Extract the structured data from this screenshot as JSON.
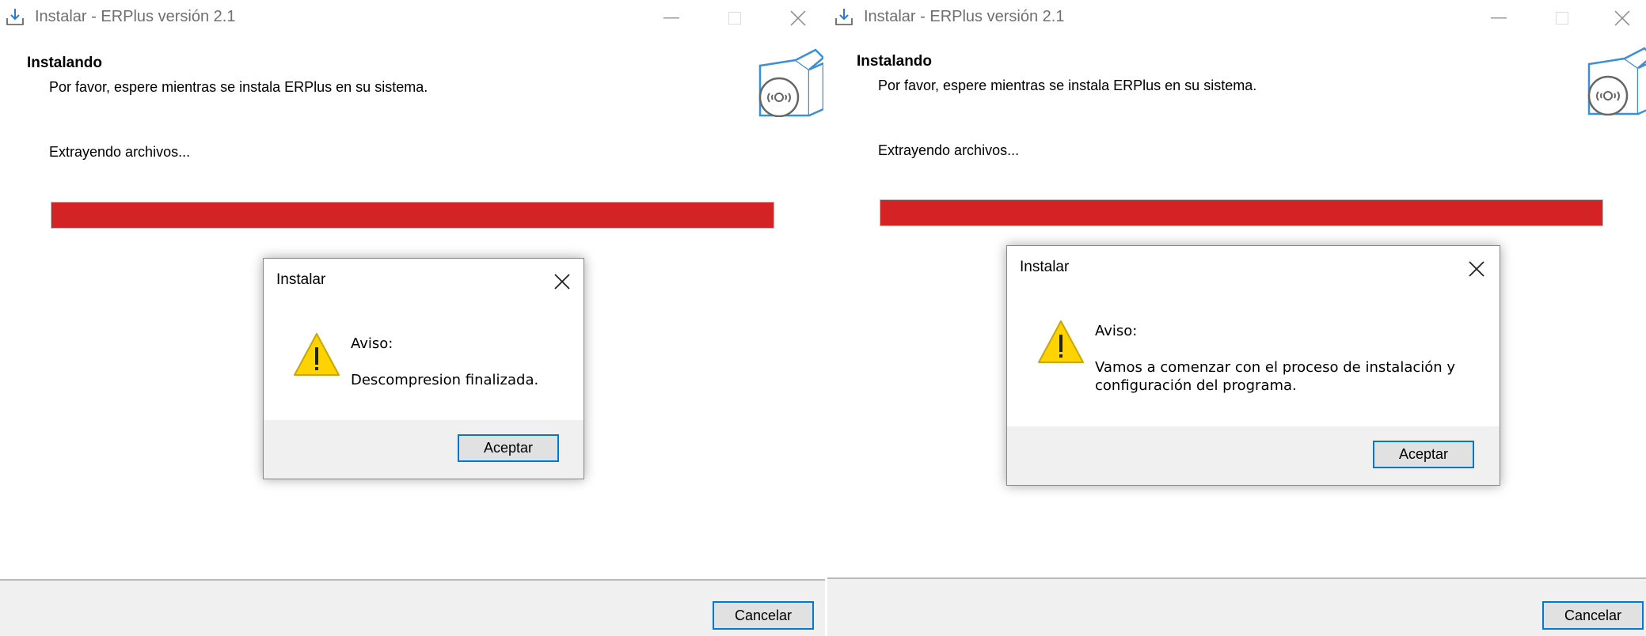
{
  "windows": [
    {
      "title": "Instalar - ERPlus versión 2.1",
      "heading": "Instalando",
      "subheading": "Por favor, espere mientras se instala ERPlus en su sistema.",
      "status": "Extrayendo archivos...",
      "progress": 1.0,
      "cancel_label": "Cancelar",
      "dialog": {
        "title": "Instalar",
        "message_title": "Aviso:",
        "message_body": "Descompresion finalizada.",
        "ok_label": "Aceptar"
      }
    },
    {
      "title": "Instalar - ERPlus versión 2.1",
      "heading": "Instalando",
      "subheading": "Por favor, espere mientras se instala ERPlus en su sistema.",
      "status": "Extrayendo archivos...",
      "progress": 1.0,
      "cancel_label": "Cancelar",
      "dialog": {
        "title": "Instalar",
        "message_title": "Aviso:",
        "message_body_line1": "Vamos a comenzar con el proceso de instalación y",
        "message_body_line2": "configuración del programa.",
        "ok_label": "Aceptar"
      }
    }
  ],
  "colors": {
    "progress_fill": "#d42324",
    "button_focus_border": "#0078d7",
    "warning_yellow": "#ffd300"
  },
  "icons": {
    "app": "download-tray-icon",
    "minimize": "minimize-icon",
    "maximize": "maximize-icon",
    "close": "close-icon",
    "banner": "software-box-disc-icon",
    "warning": "warning-triangle-icon"
  }
}
